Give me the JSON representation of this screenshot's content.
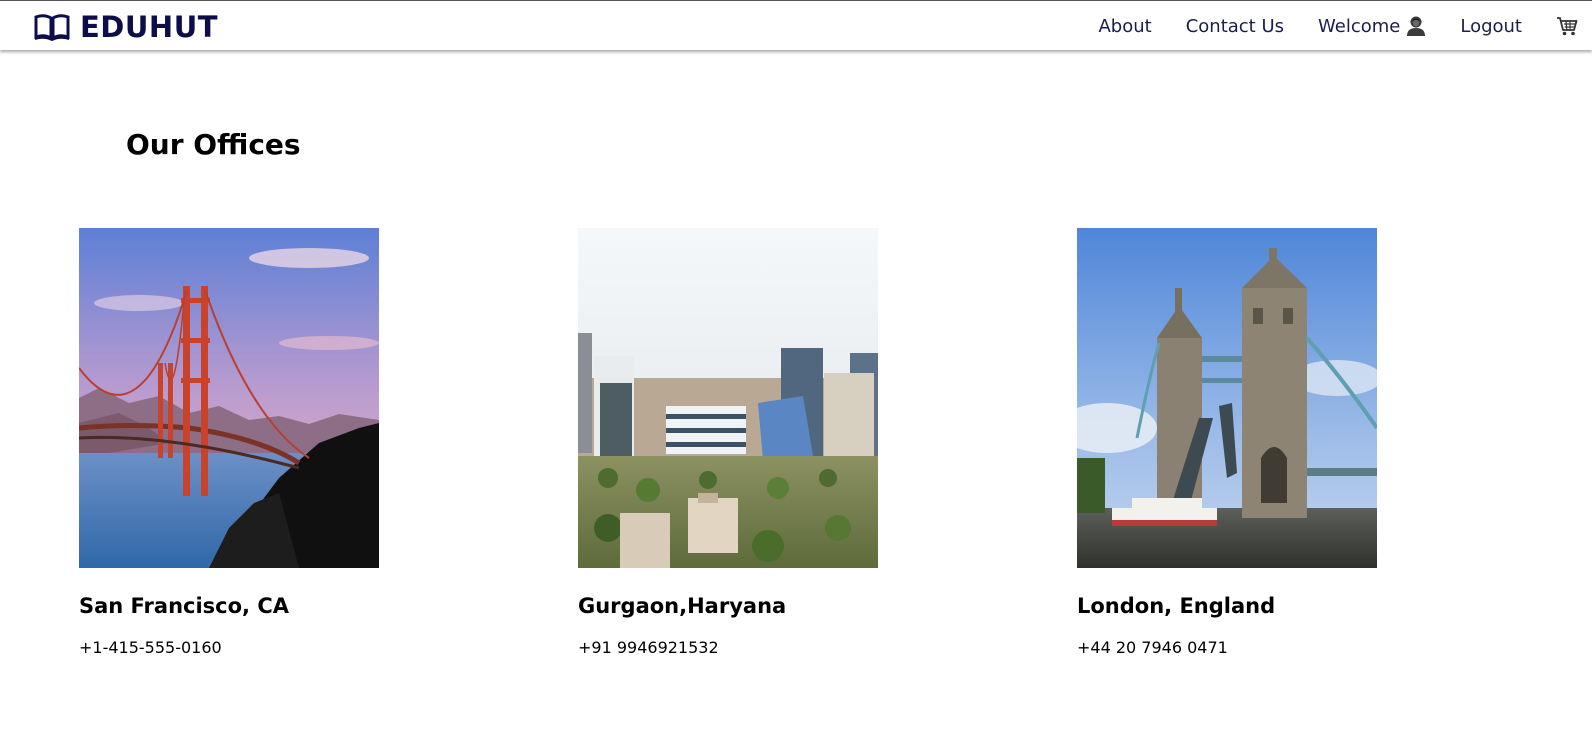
{
  "brand": {
    "name": "EDUHUT",
    "icon": "open-book-icon",
    "color": "#0d0d4a"
  },
  "nav": {
    "about": "About",
    "contact": "Contact Us",
    "welcome": "Welcome",
    "logout": "Logout",
    "user_icon": "user-avatar-icon",
    "cart_icon": "shopping-cart-icon"
  },
  "page": {
    "title": "Our Offices"
  },
  "offices": [
    {
      "city": "San Francisco, CA",
      "phone": "+1-415-555-0160"
    },
    {
      "city": "Gurgaon,Haryana",
      "phone": "+91 9946921532"
    },
    {
      "city": "London, England",
      "phone": "+44 20 7946 0471"
    }
  ]
}
